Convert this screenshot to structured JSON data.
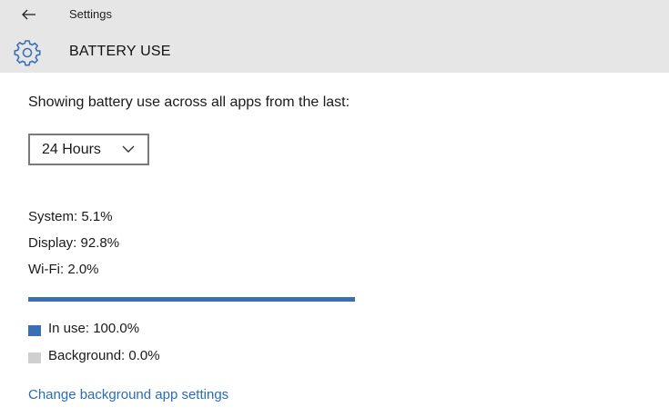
{
  "window": {
    "title": "Settings"
  },
  "page": {
    "title": "BATTERY USE",
    "icon": "gear-icon"
  },
  "intro_text": "Showing battery use across all apps from the last:",
  "time_range": {
    "selected": "24 Hours"
  },
  "stats": {
    "system": "System: 5.1%",
    "display": "Display: 92.8%",
    "wifi": "Wi-Fi: 2.0%"
  },
  "usage": {
    "in_use_percent": 100.0,
    "in_use_label": "In use: 100.0%",
    "background_label": "Background: 0.0%"
  },
  "colors": {
    "header_bg": "#e6e6e6",
    "accent": "#3a6fb5",
    "background_swatch": "#cfcfcf",
    "link": "#2a6cb6"
  },
  "link": {
    "label": "Change background app settings"
  }
}
